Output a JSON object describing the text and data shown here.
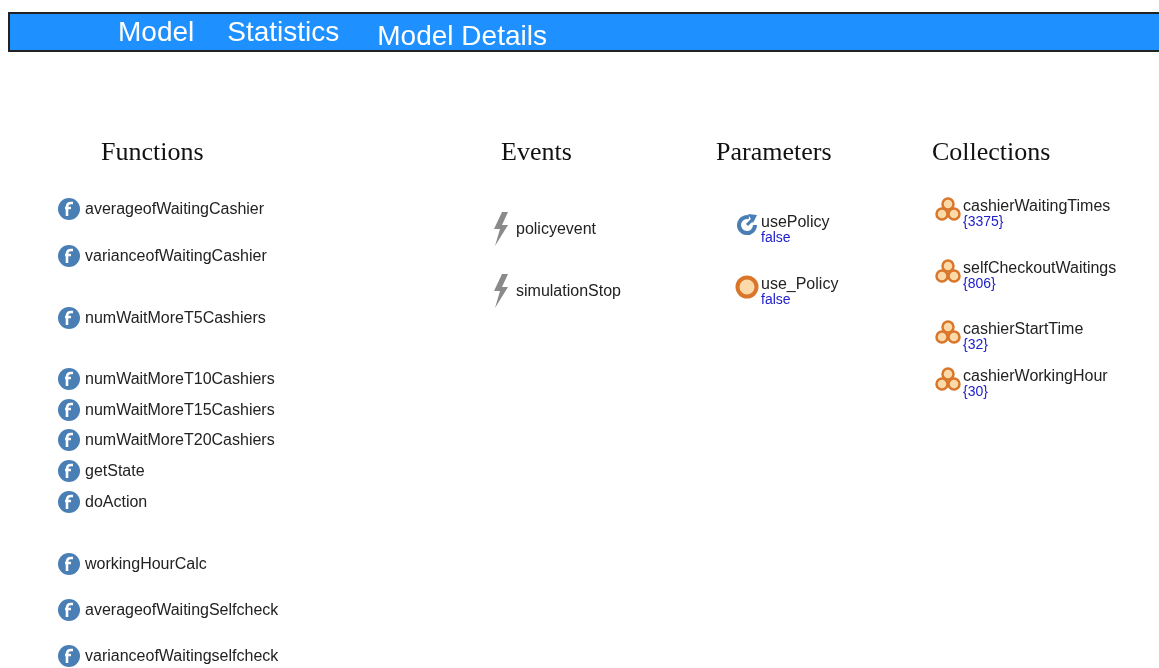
{
  "tabs": [
    {
      "label": "Model"
    },
    {
      "label": "Statistics"
    },
    {
      "label": "Model Details"
    }
  ],
  "functions": {
    "title": "Functions",
    "items": [
      "averageofWaitingCashier",
      "varianceofWaitingCashier",
      "numWaitMoreT5Cashiers",
      "numWaitMoreT10Cashiers",
      "numWaitMoreT15Cashiers",
      "numWaitMoreT20Cashiers",
      "getState",
      "doAction",
      "workingHourCalc",
      "averageofWaitingSelfcheck",
      "varianceofWaitingselfcheck"
    ]
  },
  "events": {
    "title": "Events",
    "items": [
      "policyevent",
      "simulationStop"
    ]
  },
  "parameters": {
    "title": "Parameters",
    "items": [
      {
        "kind": "dynamic",
        "name": "usePolicy",
        "value": "false"
      },
      {
        "kind": "plain",
        "name": "use_Policy",
        "value": "false"
      }
    ]
  },
  "collections": {
    "title": "Collections",
    "items": [
      {
        "name": "cashierWaitingTimes",
        "value": "{3375}"
      },
      {
        "name": "selfCheckoutWaitings",
        "value": "{806}"
      },
      {
        "name": "cashierStartTime",
        "value": "{32}"
      },
      {
        "name": "cashierWorkingHour",
        "value": "{30}"
      }
    ]
  }
}
